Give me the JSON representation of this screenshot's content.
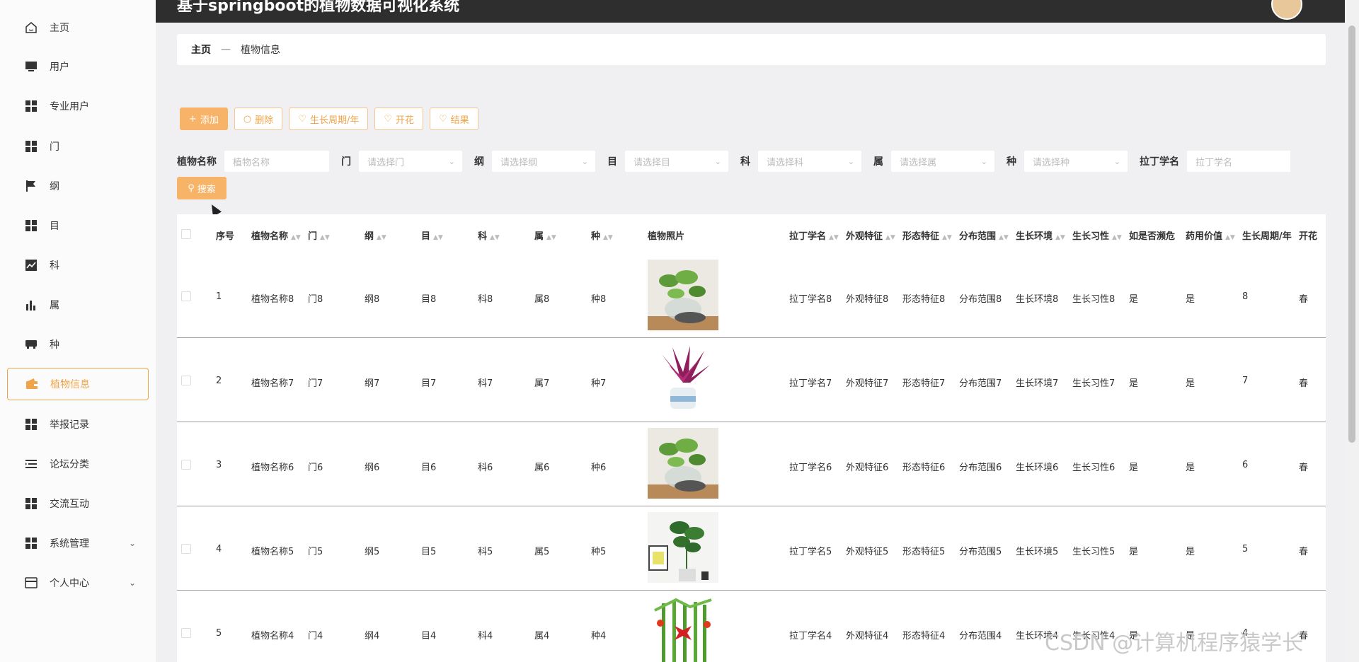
{
  "app": {
    "title": "基于springboot的植物数据可视化系统"
  },
  "sidebar": {
    "items": [
      {
        "label": "主页",
        "icon": "home-icon"
      },
      {
        "label": "用户",
        "icon": "monitor-icon"
      },
      {
        "label": "专业用户",
        "icon": "grid-icon"
      },
      {
        "label": "门",
        "icon": "grid-icon"
      },
      {
        "label": "纲",
        "icon": "flag-icon"
      },
      {
        "label": "目",
        "icon": "grid-icon"
      },
      {
        "label": "科",
        "icon": "line-chart-icon"
      },
      {
        "label": "属",
        "icon": "bar-chart-icon"
      },
      {
        "label": "种",
        "icon": "inbox-icon"
      },
      {
        "label": "植物信息",
        "icon": "wallet-icon",
        "active": true
      },
      {
        "label": "举报记录",
        "icon": "grid-icon"
      },
      {
        "label": "论坛分类",
        "icon": "list-icon"
      },
      {
        "label": "交流互动",
        "icon": "grid-icon"
      },
      {
        "label": "系统管理",
        "icon": "grid-icon",
        "expandable": true
      },
      {
        "label": "个人中心",
        "icon": "card-icon",
        "expandable": true
      }
    ]
  },
  "breadcrumb": {
    "home": "主页",
    "separator": "—",
    "current": "植物信息"
  },
  "actions": {
    "add": "添加",
    "delete": "删除",
    "cycle": "生长周期/年",
    "flower": "开花",
    "fruit": "结果"
  },
  "filters": {
    "name_label": "植物名称",
    "name_placeholder": "植物名称",
    "men_label": "门",
    "men_placeholder": "请选择门",
    "gang_label": "纲",
    "gang_placeholder": "请选择纲",
    "mu_label": "目",
    "mu_placeholder": "请选择目",
    "ke_label": "科",
    "ke_placeholder": "请选择科",
    "shu_label": "属",
    "shu_placeholder": "请选择属",
    "zhong_label": "种",
    "zhong_placeholder": "请选择种",
    "latin_label": "拉丁学名",
    "latin_placeholder": "拉丁学名",
    "search": "搜索"
  },
  "table": {
    "headers": [
      "序号",
      "植物名称",
      "门",
      "纲",
      "目",
      "科",
      "属",
      "种",
      "植物照片",
      "拉丁学名",
      "外观特征",
      "形态特征",
      "分布范围",
      "生长环境",
      "生长习性",
      "如是否濒危",
      "药用价值",
      "生长周期/年",
      "开花"
    ],
    "rows": [
      [
        "1",
        "植物名称8",
        "门8",
        "纲8",
        "目8",
        "科8",
        "属8",
        "种8",
        "拉丁学名8",
        "外观特征8",
        "形态特征8",
        "分布范围8",
        "生长环境8",
        "生长习性8",
        "是",
        "是",
        "8",
        "春"
      ],
      [
        "2",
        "植物名称7",
        "门7",
        "纲7",
        "目7",
        "科7",
        "属7",
        "种7",
        "拉丁学名7",
        "外观特征7",
        "形态特征7",
        "分布范围7",
        "生长环境7",
        "生长习性7",
        "是",
        "是",
        "7",
        "春"
      ],
      [
        "3",
        "植物名称6",
        "门6",
        "纲6",
        "目6",
        "科6",
        "属6",
        "种6",
        "拉丁学名6",
        "外观特征6",
        "形态特征6",
        "分布范围6",
        "生长环境6",
        "生长习性6",
        "是",
        "是",
        "6",
        "春"
      ],
      [
        "4",
        "植物名称5",
        "门5",
        "纲5",
        "目5",
        "科5",
        "属5",
        "种5",
        "拉丁学名5",
        "外观特征5",
        "形态特征5",
        "分布范围5",
        "生长环境5",
        "生长习性5",
        "是",
        "是",
        "5",
        "春"
      ],
      [
        "5",
        "植物名称4",
        "门4",
        "纲4",
        "目4",
        "科4",
        "属4",
        "种4",
        "拉丁学名4",
        "外观特征4",
        "形态特征4",
        "分布范围4",
        "生长环境4",
        "生长习性4",
        "是",
        "是",
        "4",
        "春"
      ]
    ]
  },
  "watermark": "CSDN @计算机程序猿学长",
  "colors": {
    "accent": "#f0a449",
    "button": "#f7b368",
    "topbar": "#2e2e2e"
  }
}
